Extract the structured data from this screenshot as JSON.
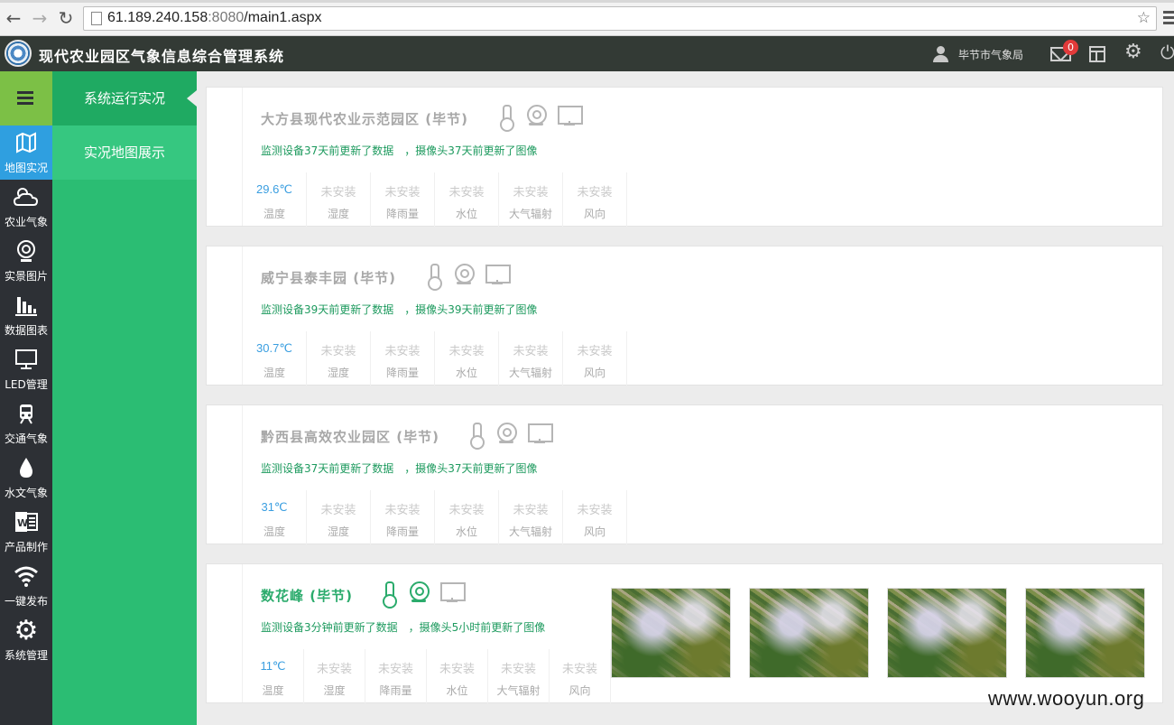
{
  "browser": {
    "url_host": "61.189.240.158",
    "url_port": ":8080",
    "url_path": "/main1.aspx"
  },
  "header": {
    "title": "现代农业园区气象信息综合管理系统",
    "user_name": "毕节市气象局",
    "mail_badge": "0"
  },
  "sidebar": {
    "items": [
      {
        "label": "地图实况",
        "icon": "map-icon"
      },
      {
        "label": "农业气象",
        "icon": "cloud-sun-icon"
      },
      {
        "label": "实景图片",
        "icon": "camera-icon"
      },
      {
        "label": "数据图表",
        "icon": "bar-chart-icon"
      },
      {
        "label": "LED管理",
        "icon": "monitor-icon"
      },
      {
        "label": "交通气象",
        "icon": "train-icon"
      },
      {
        "label": "水文气象",
        "icon": "water-drop-icon"
      },
      {
        "label": "产品制作",
        "icon": "word-doc-icon"
      },
      {
        "label": "一键发布",
        "icon": "wifi-icon"
      },
      {
        "label": "系统管理",
        "icon": "gear-icon"
      }
    ]
  },
  "submenu": {
    "items": [
      {
        "label": "系统运行实况"
      },
      {
        "label": "实况地图展示"
      }
    ]
  },
  "metric_labels": [
    "温度",
    "湿度",
    "降雨量",
    "水位",
    "大气辐射",
    "风向"
  ],
  "cards": [
    {
      "title": "大方县现代农业示范园区 (毕节)",
      "status_data": "监测设备37天前更新了数据",
      "status_image": "，摄像头37天前更新了图像",
      "values": [
        "29.6℃",
        "未安装",
        "未安装",
        "未安装",
        "未安装",
        "未安装"
      ]
    },
    {
      "title": "威宁县泰丰园 (毕节)",
      "status_data": "监测设备39天前更新了数据",
      "status_image": "，摄像头39天前更新了图像",
      "values": [
        "30.7℃",
        "未安装",
        "未安装",
        "未安装",
        "未安装",
        "未安装"
      ]
    },
    {
      "title": "黔西县高效农业园区 (毕节)",
      "status_data": "监测设备37天前更新了数据",
      "status_image": "，摄像头37天前更新了图像",
      "values": [
        "31℃",
        "未安装",
        "未安装",
        "未安装",
        "未安装",
        "未安装"
      ]
    },
    {
      "title": "数花峰 (毕节)",
      "status_data": "监测设备3分钟前更新了数据",
      "status_image": "，摄像头5小时前更新了图像",
      "values": [
        "11℃",
        "未安装",
        "未安装",
        "未安装",
        "未安装",
        "未安装"
      ]
    }
  ],
  "colors": {
    "header_bg": "#333a35",
    "sidebar_bg": "#2d3035",
    "sidebar_active": "#2f9fe0",
    "menu_toggle": "#7cc046",
    "submenu_bg": "#2bbd73",
    "status_green": "#1d9a5e",
    "live_value_blue": "#3a9ee0"
  },
  "watermark": "www.wooyun.org"
}
